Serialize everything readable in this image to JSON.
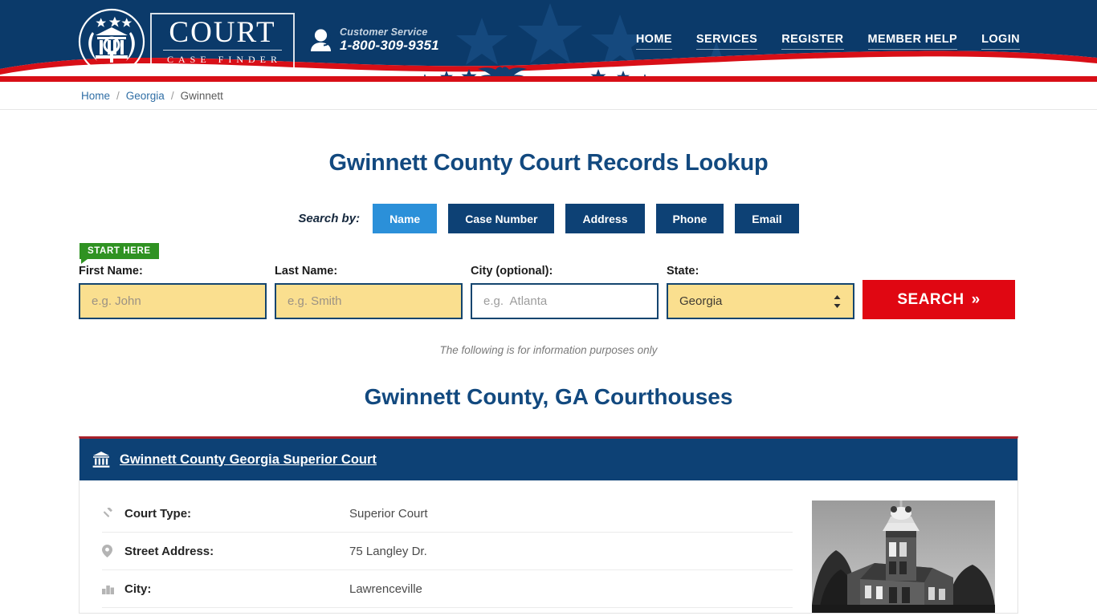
{
  "header": {
    "logo": {
      "seal_icon": "court-seal-icon",
      "primary": "COURT",
      "secondary": "CASE FINDER"
    },
    "customer_service": {
      "icon": "headset-support-icon",
      "label": "Customer Service",
      "phone": "1-800-309-9351"
    },
    "nav": [
      {
        "label": "HOME"
      },
      {
        "label": "SERVICES"
      },
      {
        "label": "REGISTER"
      },
      {
        "label": "MEMBER HELP"
      },
      {
        "label": "LOGIN"
      }
    ],
    "colors": {
      "navy": "#0b3a6a",
      "red": "#d80f17"
    }
  },
  "breadcrumb": {
    "items": [
      {
        "label": "Home",
        "link": true
      },
      {
        "label": "Georgia",
        "link": true
      },
      {
        "label": "Gwinnett",
        "link": false
      }
    ],
    "separator": "/"
  },
  "main": {
    "page_title": "Gwinnett County Court Records Lookup",
    "search_by_label": "Search by:",
    "tabs": [
      {
        "label": "Name",
        "active": true
      },
      {
        "label": "Case Number",
        "active": false
      },
      {
        "label": "Address",
        "active": false
      },
      {
        "label": "Phone",
        "active": false
      },
      {
        "label": "Email",
        "active": false
      }
    ],
    "start_here_badge": "START HERE",
    "form": {
      "first_name": {
        "label": "First Name:",
        "value": "",
        "placeholder": "e.g. John"
      },
      "last_name": {
        "label": "Last Name:",
        "value": "",
        "placeholder": "e.g. Smith"
      },
      "city": {
        "label": "City (optional):",
        "value": "",
        "placeholder": "e.g.  Atlanta"
      },
      "state": {
        "label": "State:",
        "value": "Georgia"
      },
      "search_button": "SEARCH",
      "search_button_chevron": "»"
    },
    "disclaimer": "The following is for information purposes only",
    "section_title": "Gwinnett County, GA Courthouses"
  },
  "court_card": {
    "icon": "bank-columns-icon",
    "title": "Gwinnett County Georgia Superior Court",
    "photo_alt": "gwinnett-county-courthouse-photo",
    "rows": [
      {
        "icon": "gavel-icon",
        "label": "Court Type:",
        "value": "Superior Court"
      },
      {
        "icon": "map-pin-icon",
        "label": "Street Address:",
        "value": "75 Langley Dr."
      },
      {
        "icon": "city-buildings-icon",
        "label": "City:",
        "value": "Lawrenceville"
      }
    ]
  },
  "colors": {
    "navy_dark": "#0d4175",
    "navy_header": "#0b3a6a",
    "accent_blue": "#2b90d9",
    "red": "#e00712",
    "green": "#2f9222",
    "field_yellow": "#fadf8f",
    "title_blue": "#12497f"
  }
}
